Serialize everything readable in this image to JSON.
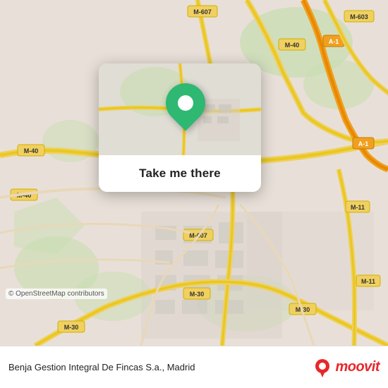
{
  "map": {
    "background_color": "#e8e0d8",
    "attribution": "© OpenStreetMap contributors"
  },
  "popup": {
    "button_label": "Take me there",
    "pin_color": "#2eb872"
  },
  "bottom_bar": {
    "place_name": "Benja Gestion Integral De Fincas S.a., Madrid",
    "logo_text": "moovit"
  },
  "roads": [
    {
      "id": "M-607",
      "color": "#f0d060"
    },
    {
      "id": "M-40",
      "color": "#f0d060"
    },
    {
      "id": "M-30",
      "color": "#f0d060"
    },
    {
      "id": "A-1",
      "color": "#f0a020"
    },
    {
      "id": "M-11",
      "color": "#f0d060"
    },
    {
      "id": "M-603",
      "color": "#f0d060"
    }
  ]
}
